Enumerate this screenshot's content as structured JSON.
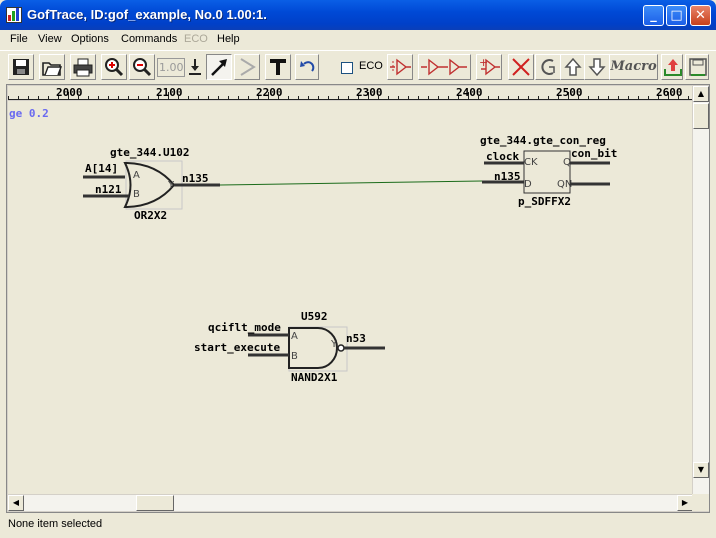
{
  "window": {
    "title": "GofTrace, ID:gof_example, No.0 1.00:1.",
    "minimize_label": "_",
    "maximize_label": "□",
    "close_label": "✕"
  },
  "menu": {
    "items": [
      "File",
      "View",
      "Options",
      "Commands",
      "ECO",
      "Help"
    ]
  },
  "toolbar": {
    "zoom_value": "1.00",
    "eco_label": "ECO",
    "eco_checked": false,
    "macro_label": "Macro"
  },
  "ruler": {
    "labels": [
      "2000",
      "2100",
      "2200",
      "2300",
      "2400",
      "2500",
      "2600"
    ]
  },
  "schematic": {
    "corner_label": "ge 0.2",
    "or_gate": {
      "instance": "gte_344.U102",
      "cell": "OR2X2",
      "in_a_net": "A[14]",
      "in_b_net": "n121",
      "out_net": "n135",
      "pin_a": "A",
      "pin_b": "B",
      "pin_y": "Y"
    },
    "dff": {
      "instance": "gte_344.gte_con_reg",
      "cell": "p_SDFFX2",
      "clk_net": "clock",
      "d_net": "n135",
      "q_net": "con_bit",
      "pin_ck": "CK",
      "pin_d": "D",
      "pin_q": "Q",
      "pin_qn": "QN"
    },
    "nand_gate": {
      "instance": "U592",
      "cell": "NAND2X1",
      "in_a_net": "qciflt_mode",
      "in_b_net": "start_execute",
      "out_net": "n53",
      "pin_a": "A",
      "pin_b": "B",
      "pin_y": "Y"
    },
    "colors": {
      "wire": "#1a6b1a",
      "pin": "#333333",
      "corner_label": "#6a6af0"
    }
  },
  "status": {
    "text": "None item selected"
  }
}
